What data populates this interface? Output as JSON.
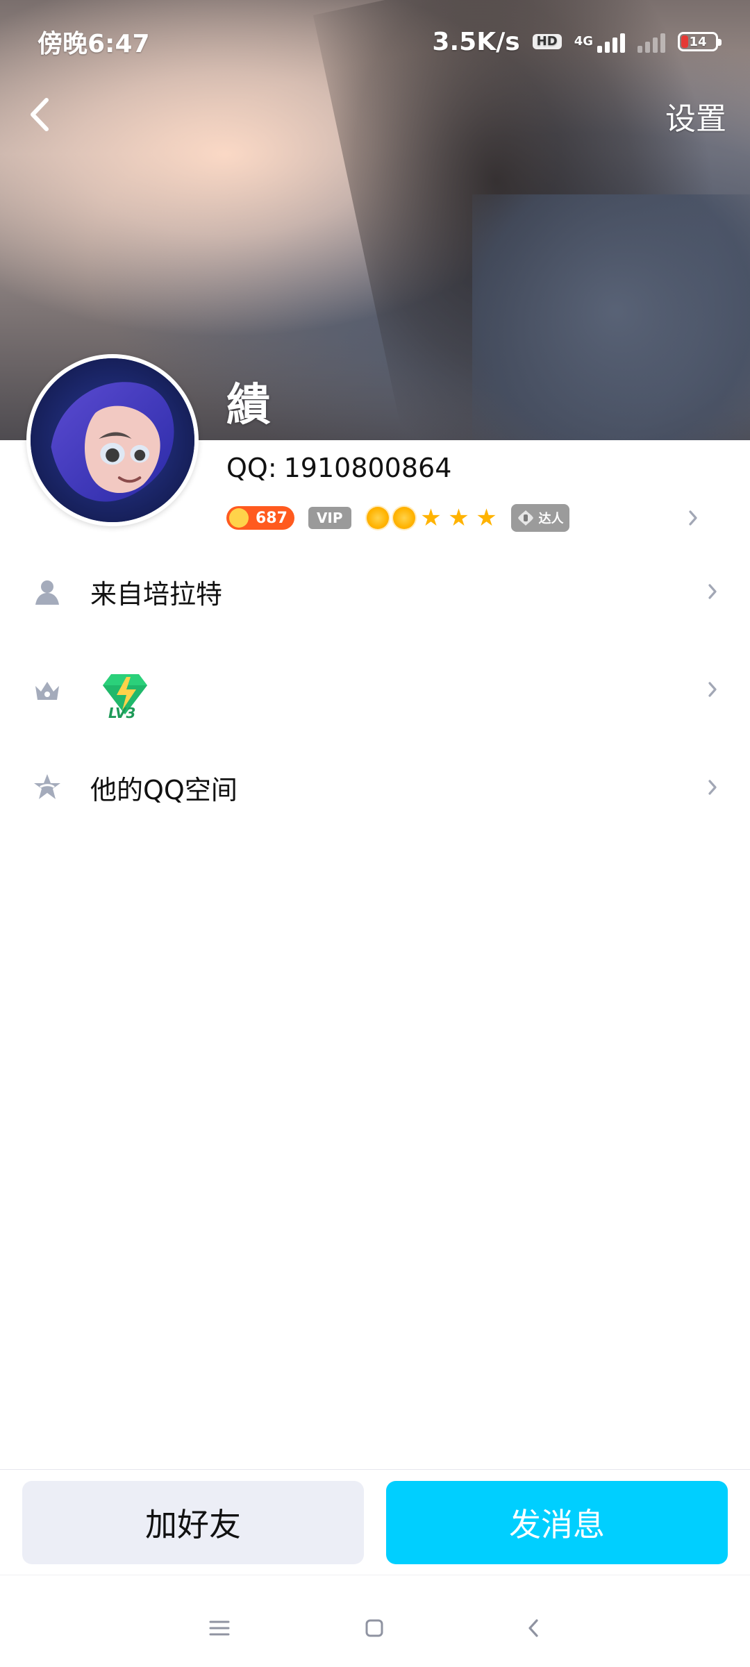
{
  "status_bar": {
    "time": "傍晚6:47",
    "network_speed": "3.5K/s",
    "hd_label": "HD",
    "network_type": "4G",
    "battery_level": "14"
  },
  "top_nav": {
    "settings_label": "设置"
  },
  "profile": {
    "nickname": "繢",
    "qq_label": "QQ:",
    "qq_number": "1910800864",
    "coin_count": "687",
    "vip_label": "VIP",
    "talent_label": "达人"
  },
  "list": {
    "location_label": "来自培拉特",
    "level_label": "LV3",
    "qzone_label": "他的QQ空间"
  },
  "actions": {
    "add_friend_label": "加好友",
    "send_message_label": "发消息"
  }
}
